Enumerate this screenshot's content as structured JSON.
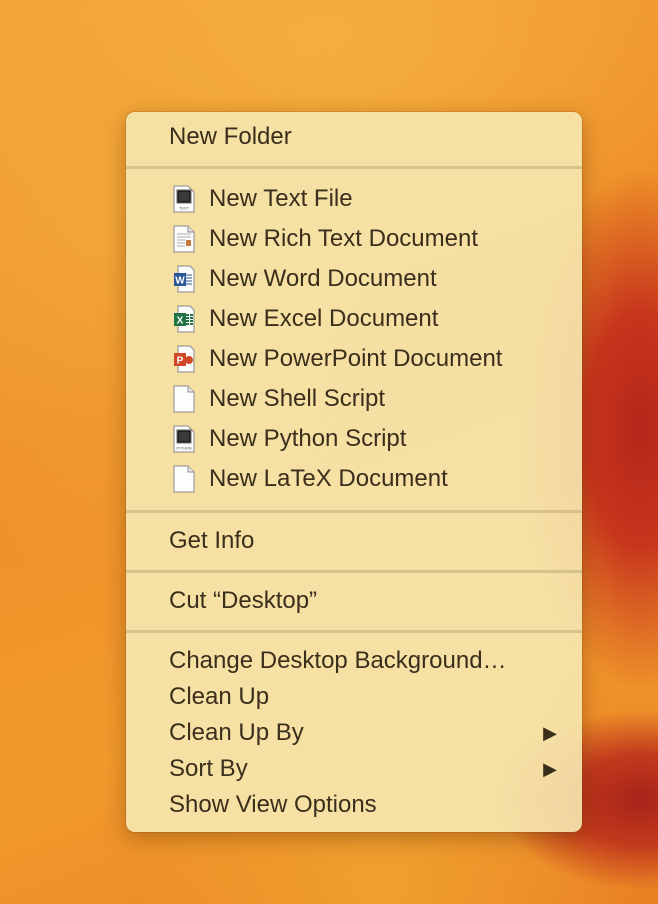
{
  "context_menu": {
    "new_folder": "New Folder",
    "new_items": [
      {
        "label": "New Text File",
        "icon": "text-file-icon"
      },
      {
        "label": "New Rich Text Document",
        "icon": "rich-text-document-icon"
      },
      {
        "label": "New Word Document",
        "icon": "word-document-icon"
      },
      {
        "label": "New Excel Document",
        "icon": "excel-document-icon"
      },
      {
        "label": "New PowerPoint Document",
        "icon": "powerpoint-document-icon"
      },
      {
        "label": "New Shell Script",
        "icon": "blank-document-icon"
      },
      {
        "label": "New Python Script",
        "icon": "python-script-icon"
      },
      {
        "label": "New LaTeX Document",
        "icon": "blank-document-icon"
      }
    ],
    "icon_captions": {
      "text": "TEXT",
      "python": "PYTHON",
      "word": "W",
      "excel": "X",
      "powerpoint": "P"
    },
    "get_info": "Get Info",
    "cut": "Cut “Desktop”",
    "view_items": [
      {
        "label": "Change Desktop Background…",
        "submenu": false
      },
      {
        "label": "Clean Up",
        "submenu": false
      },
      {
        "label": "Clean Up By",
        "submenu": true
      },
      {
        "label": "Sort By",
        "submenu": true
      },
      {
        "label": "Show View Options",
        "submenu": false
      }
    ],
    "submenu_glyph": "▶"
  },
  "colors": {
    "menu_background": "#f6e8b0",
    "menu_text": "#3a2e1c",
    "wallpaper_orange": "#f19a2c",
    "wallpaper_red": "#b5261a",
    "word_blue": "#2b579a",
    "excel_green": "#217346",
    "powerpoint_red": "#d24726"
  }
}
